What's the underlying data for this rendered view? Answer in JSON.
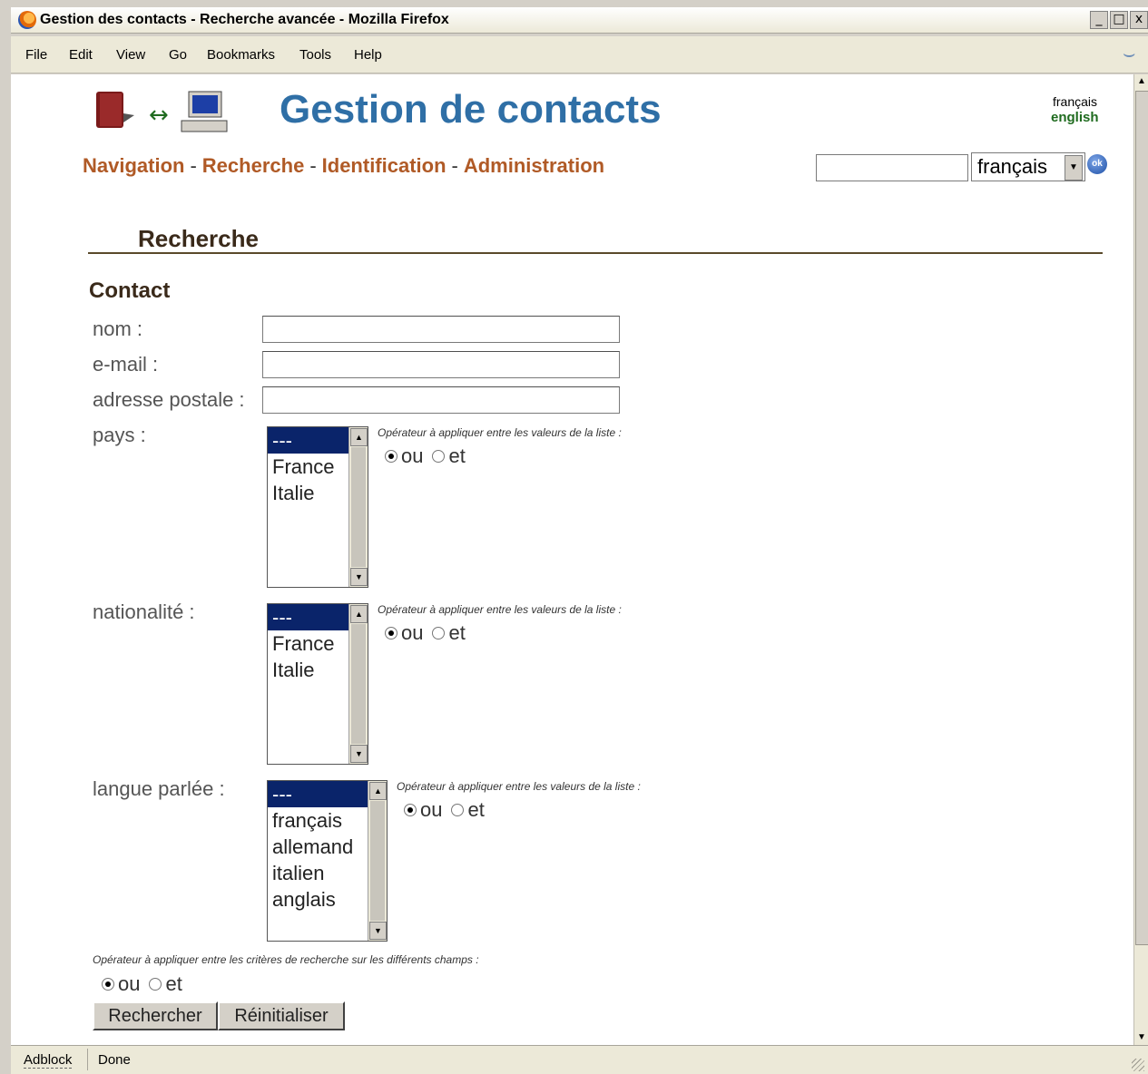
{
  "window": {
    "title": "Gestion des contacts - Recherche avancée - Mozilla Firefox",
    "buttons": [
      "_",
      "□",
      "x"
    ]
  },
  "menubar": {
    "items": [
      "File",
      "Edit",
      "View",
      "Go",
      "Bookmarks",
      "Tools",
      "Help"
    ]
  },
  "header": {
    "site_title": "Gestion de contacts",
    "lang_fr": "français",
    "lang_en": "english"
  },
  "nav": {
    "links": [
      "Navigation",
      "Recherche",
      "Identification",
      "Administration"
    ],
    "separator": "-"
  },
  "quick_search": {
    "value": "",
    "language_selected": "français",
    "ok_label": "ok"
  },
  "page": {
    "section_title": "Recherche",
    "subsection_title": "Contact"
  },
  "form": {
    "nom_label": "nom :",
    "email_label": "e-mail :",
    "adresse_label": "adresse postale :",
    "pays": {
      "label": "pays :",
      "options": [
        "---",
        "France",
        "Italie"
      ],
      "selected_index": 0,
      "operator_note": "Opérateur à appliquer entre les valeurs de la liste :",
      "ou": "ou",
      "et": "et",
      "checked": "ou"
    },
    "nationalite": {
      "label": "nationalité :",
      "options": [
        "---",
        "France",
        "Italie"
      ],
      "selected_index": 0,
      "operator_note": "Opérateur à appliquer entre les valeurs de la liste :",
      "ou": "ou",
      "et": "et",
      "checked": "ou"
    },
    "langue": {
      "label": "langue parlée :",
      "options": [
        "---",
        "français",
        "allemand",
        "italien",
        "anglais"
      ],
      "selected_index": 0,
      "operator_note": "Opérateur à appliquer entre les valeurs de la liste :",
      "ou": "ou",
      "et": "et",
      "checked": "ou"
    },
    "global_operator": {
      "note": "Opérateur à appliquer entre les critères de recherche sur les différents champs :",
      "ou": "ou",
      "et": "et",
      "checked": "ou"
    },
    "submit_label": "Rechercher",
    "reset_label": "Réinitialiser"
  },
  "statusbar": {
    "adblock": "Adblock",
    "status": "Done"
  },
  "colors": {
    "title_blue": "#2f6fa6",
    "nav_link": "#b05a26",
    "english_link": "#1f6b1f",
    "selection": "#0a246a"
  }
}
